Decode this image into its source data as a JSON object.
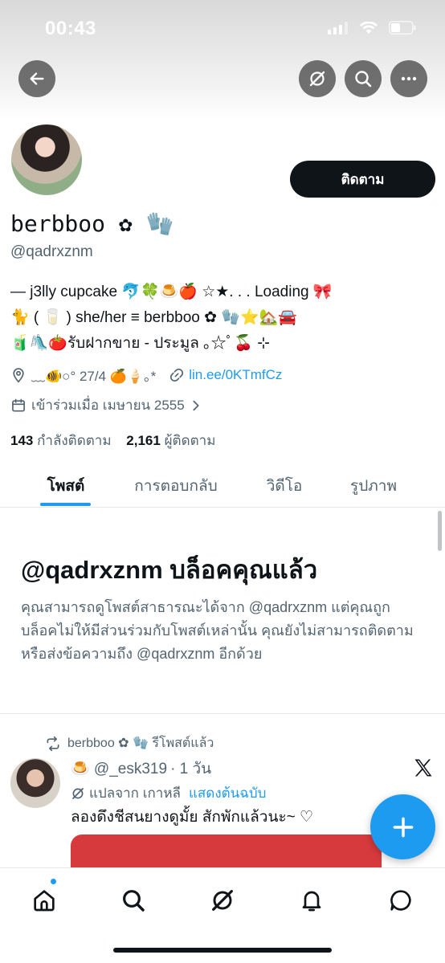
{
  "status_bar": {
    "time": "00:43"
  },
  "header": {
    "back_icon": "arrow-left-icon",
    "grok_icon": "grok-slash-icon",
    "search_icon": "search-icon",
    "more_icon": "more-horizontal-icon"
  },
  "profile": {
    "follow_label": "ติดตาม",
    "display_name": "berbboo ✿ 🧤",
    "handle": "@qadrxznm",
    "bio_lines": [
      "— j3lly cupcake 🐬🍀🍮🍎 ☆★. . .  Loading 🎀",
      "🐈 ( 🥛 ) she/her ≡ berbboo ✿ 🧤⭐🏡🚘",
      "🧃🛝🍅รับฝากขาย - ประมูล ｡☆ﾟ🍒 ⊹"
    ],
    "location": "﹏🐠○° 27/4 🍊🍦｡*",
    "website": "lin.ee/0KTmfCz",
    "joined": "เข้าร่วมเมื่อ เมษายน 2555",
    "following_count": "143",
    "following_label": "กำลังติดตาม",
    "followers_count": "2,161",
    "followers_label": "ผู้ติดตาม"
  },
  "tabs": [
    {
      "label": "โพสต์",
      "active": true
    },
    {
      "label": "การตอบกลับ",
      "active": false
    },
    {
      "label": "วิดีโอ",
      "active": false
    },
    {
      "label": "รูปภาพ",
      "active": false
    }
  ],
  "blocked": {
    "title": "@qadrxznm บล็อคคุณแล้ว",
    "message": "คุณสามารถดูโพสต์สาธารณะได้จาก @qadrxznm แต่คุณถูกบล็อคไม่ให้มีส่วนร่วมกับโพสต์เหล่านั้น คุณยังไม่สามารถติดตามหรือส่งข้อความถึง @qadrxznm อีกด้วย"
  },
  "post": {
    "repost_by": "berbboo ✿ 🧤 รีโพสต์แล้ว",
    "author": "🍮 @_esk319",
    "time": "· 1 วัน",
    "translated_from": "แปลจาก เกาหลี",
    "show_original": "แสดงต้นฉบับ",
    "text": "ลองดึงชีสนยางดูมั้ย สักพักแล้วนะ~ ♡"
  },
  "fab": {
    "icon": "plus-icon"
  },
  "bottom_nav": [
    {
      "icon": "home-icon"
    },
    {
      "icon": "search-icon"
    },
    {
      "icon": "grok-icon"
    },
    {
      "icon": "bell-icon"
    },
    {
      "icon": "messages-icon"
    }
  ],
  "colors": {
    "accent": "#1d9bf0",
    "text": "#0f1419",
    "secondary": "#536471"
  }
}
